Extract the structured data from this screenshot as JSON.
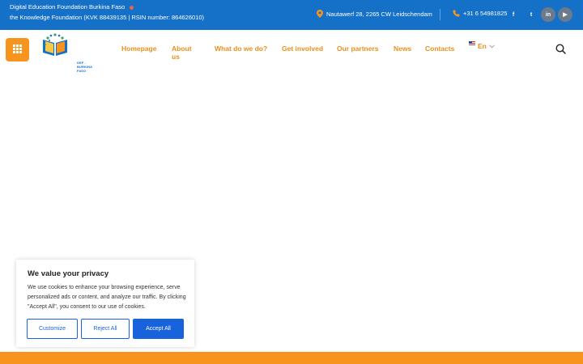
{
  "topbar": {
    "org_name": "Digital Education Foundation Burkina Faso",
    "org_detail": "the Knowledge Foundation (KVK 88439135 | RSIN number: 864626010)",
    "address": "Nautawerf 28, 2265 CW Leidschendam",
    "phone": "+31 6 54981825",
    "social": [
      {
        "name": "facebook",
        "glyph": "f"
      },
      {
        "name": "twitter",
        "glyph": "t"
      },
      {
        "name": "linkedin",
        "glyph": "in"
      },
      {
        "name": "youtube",
        "glyph": "▶"
      }
    ],
    "bg_color": "#1570c7"
  },
  "header": {
    "logo_text": "DEF - BURKINA FASO",
    "nav": [
      {
        "label": "Homepage"
      },
      {
        "label": "About us"
      },
      {
        "label": "What do we do?"
      },
      {
        "label": "Get involved"
      },
      {
        "label": "Our partners"
      },
      {
        "label": "News"
      },
      {
        "label": "Contacts"
      }
    ],
    "language": "En",
    "accent_color": "#f7941d"
  },
  "cookie": {
    "title": "We value your privacy",
    "text": "We use cookies to enhance your browsing experience, serve personalized ads or content, and analyze our traffic. By clicking \"Accept All\", you consent to our use of cookies.",
    "customize_label": "Customize",
    "reject_label": "Reject All",
    "accept_label": "Accept All",
    "button_color": "#1863dc"
  }
}
